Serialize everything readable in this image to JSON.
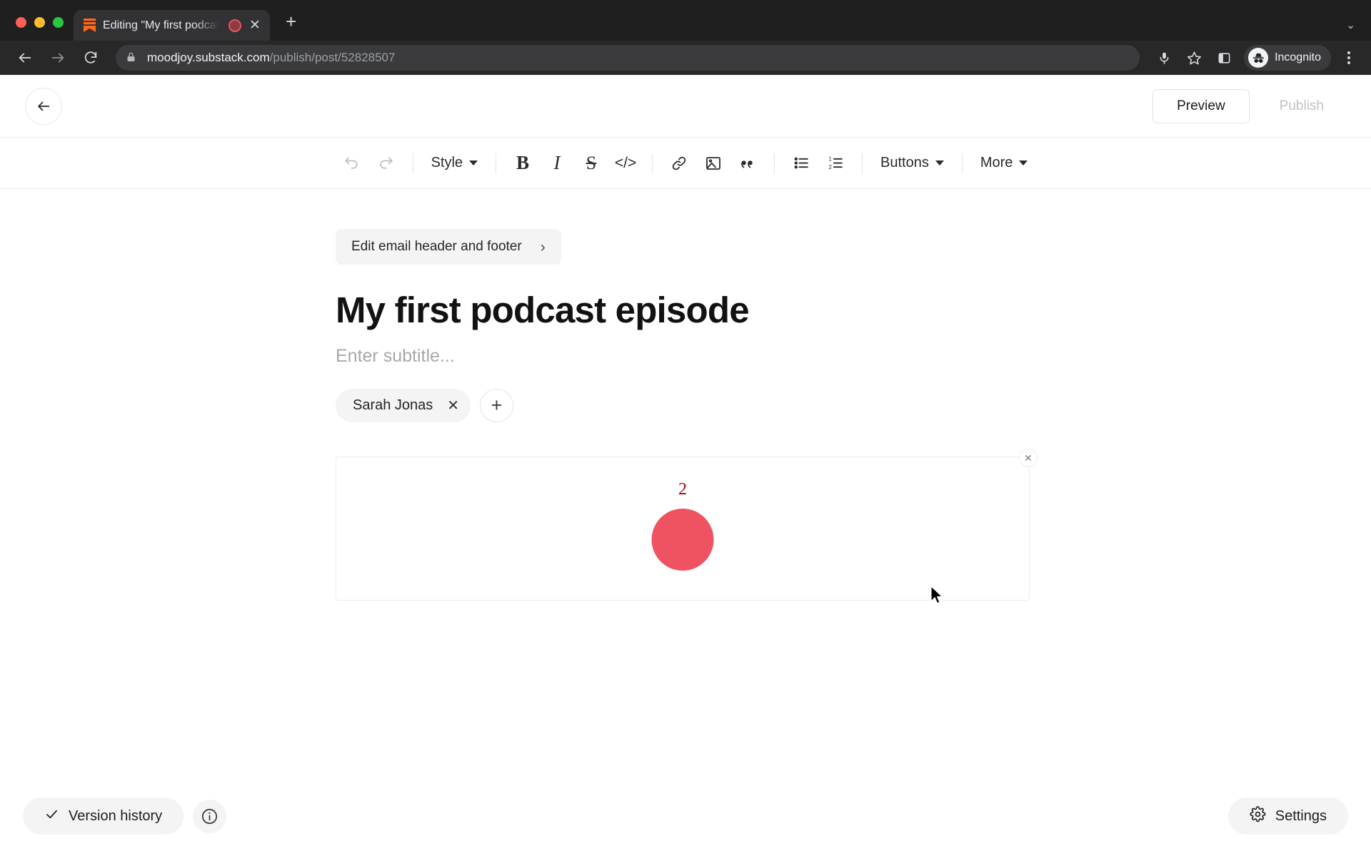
{
  "browser": {
    "tab": {
      "title": "Editing \"My first podcast e",
      "favicon_name": "substack-bookmark-icon",
      "recording_indicator": "recording-dot",
      "close_label": "✕"
    },
    "new_tab_label": "+",
    "tab_list_chevron": "⌄",
    "nav": {
      "back_label": "←",
      "forward_label": "→",
      "reload_label": "↻"
    },
    "url": {
      "domain": "moodjoy.substack.com",
      "path": "/publish/post/52828507",
      "lock_icon": "lock-icon"
    },
    "toolbar_icons": [
      "microphone-icon",
      "bookmark-star-icon",
      "side-panel-icon"
    ],
    "profile": {
      "label": "Incognito",
      "avatar_icon": "incognito-avatar-icon"
    },
    "menu_icon": "three-dot-menu-icon"
  },
  "app": {
    "header": {
      "back_icon": "arrow-left-icon",
      "preview_label": "Preview",
      "publish_label": "Publish"
    },
    "toolbar": {
      "undo_icon": "undo-icon",
      "redo_icon": "redo-icon",
      "style_label": "Style",
      "bold_label": "B",
      "italic_label": "I",
      "strikethrough_label": "S",
      "code_label": "</>",
      "link_icon": "link-icon",
      "image_icon": "image-icon",
      "quote_icon": "blockquote-icon",
      "bullet_list_icon": "bulleted-list-icon",
      "numbered_list_icon": "numbered-list-icon",
      "buttons_label": "Buttons",
      "more_label": "More"
    },
    "editor": {
      "email_header_footer_label": "Edit email header and footer",
      "email_header_footer_chevron": "›",
      "title": "My first podcast episode",
      "subtitle_placeholder": "Enter subtitle...",
      "authors": [
        {
          "name": "Sarah Jonas",
          "remove_label": "✕"
        }
      ],
      "add_author_label": "+",
      "embed": {
        "close_label": "✕",
        "number": "2",
        "shape_color": "#ef5260",
        "number_color": "#9c0020"
      }
    },
    "footer": {
      "version_history_label": "Version history",
      "version_history_icon": "check-icon",
      "info_icon": "info-circle-icon",
      "settings_label": "Settings",
      "settings_icon": "gear-icon"
    }
  }
}
